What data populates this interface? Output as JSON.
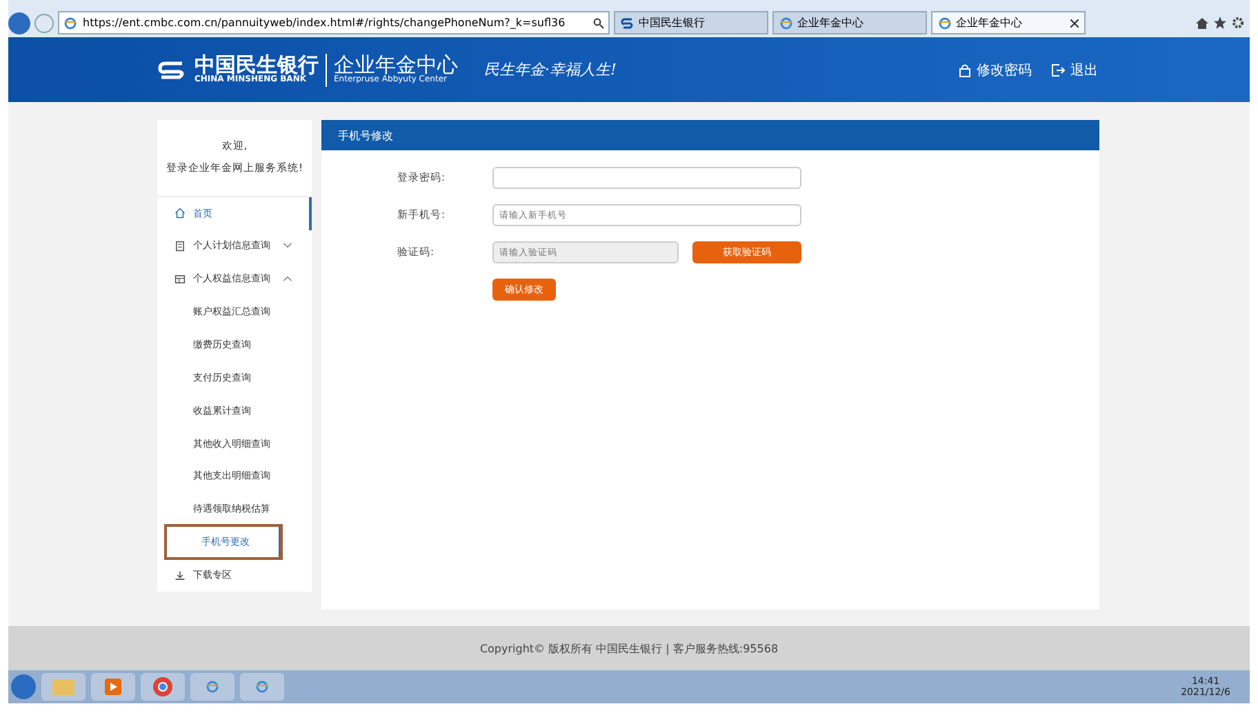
{
  "browser": {
    "url": "https://ent.cmbc.com.cn/pannuityweb/index.html#/rights/changePhoneNum?_k=sufl36",
    "tabs": [
      {
        "label": "中国民生银行",
        "selected": false,
        "kind": "bank"
      },
      {
        "label": "企业年金中心",
        "selected": false,
        "kind": "ie"
      },
      {
        "label": "企业年金中心",
        "selected": true,
        "kind": "ie"
      }
    ]
  },
  "header": {
    "bank_name": "中国民生银行",
    "bank_name_en": "CHINA MINSHENG BANK",
    "center_name": "企业年金中心",
    "center_name_en": "Enterpruse Abbyuty Center",
    "slogan": "民生年金·幸福人生!",
    "actions": [
      {
        "label": "修改密码",
        "kind": "lock"
      },
      {
        "label": "退出",
        "kind": "exit"
      }
    ]
  },
  "sidebar": {
    "welcome": [
      "欢迎,",
      "登录企业年金网上服务系统!"
    ],
    "items": [
      {
        "label": "首页",
        "kind": "home",
        "selected": true
      },
      {
        "label": "个人计划信息查询",
        "kind": "doc",
        "expanded": false
      },
      {
        "label": "个人权益信息查询",
        "kind": "card",
        "expanded": true,
        "children": [
          {
            "label": "账户权益汇总查询",
            "selected": false
          },
          {
            "label": "缴费历史查询",
            "selected": false
          },
          {
            "label": "支付历史查询",
            "selected": false
          },
          {
            "label": "收益累计查询",
            "selected": false
          },
          {
            "label": "其他收入明细查询",
            "selected": false
          },
          {
            "label": "其他支出明细查询",
            "selected": false
          },
          {
            "label": "待遇领取纳税估算",
            "selected": false
          },
          {
            "label": "手机号更改",
            "selected": true
          }
        ]
      },
      {
        "label": "下载专区",
        "kind": "download",
        "selected": false
      }
    ]
  },
  "form": {
    "title": "手机号修改",
    "fields": [
      {
        "label": "登录密码:",
        "disabled": false
      },
      {
        "label": "新手机号:",
        "placeholder": "请输入新手机号",
        "disabled": false
      },
      {
        "label": "验证码:",
        "placeholder": "请输入验证码",
        "disabled": true,
        "button": "获取验证码"
      }
    ],
    "submit": "确认修改"
  },
  "footer": "Copyright© 版权所有 中国民生银行 | 客户服务热线:95568",
  "taskbar": {
    "time": "14:41",
    "date": "2021/12/6"
  }
}
